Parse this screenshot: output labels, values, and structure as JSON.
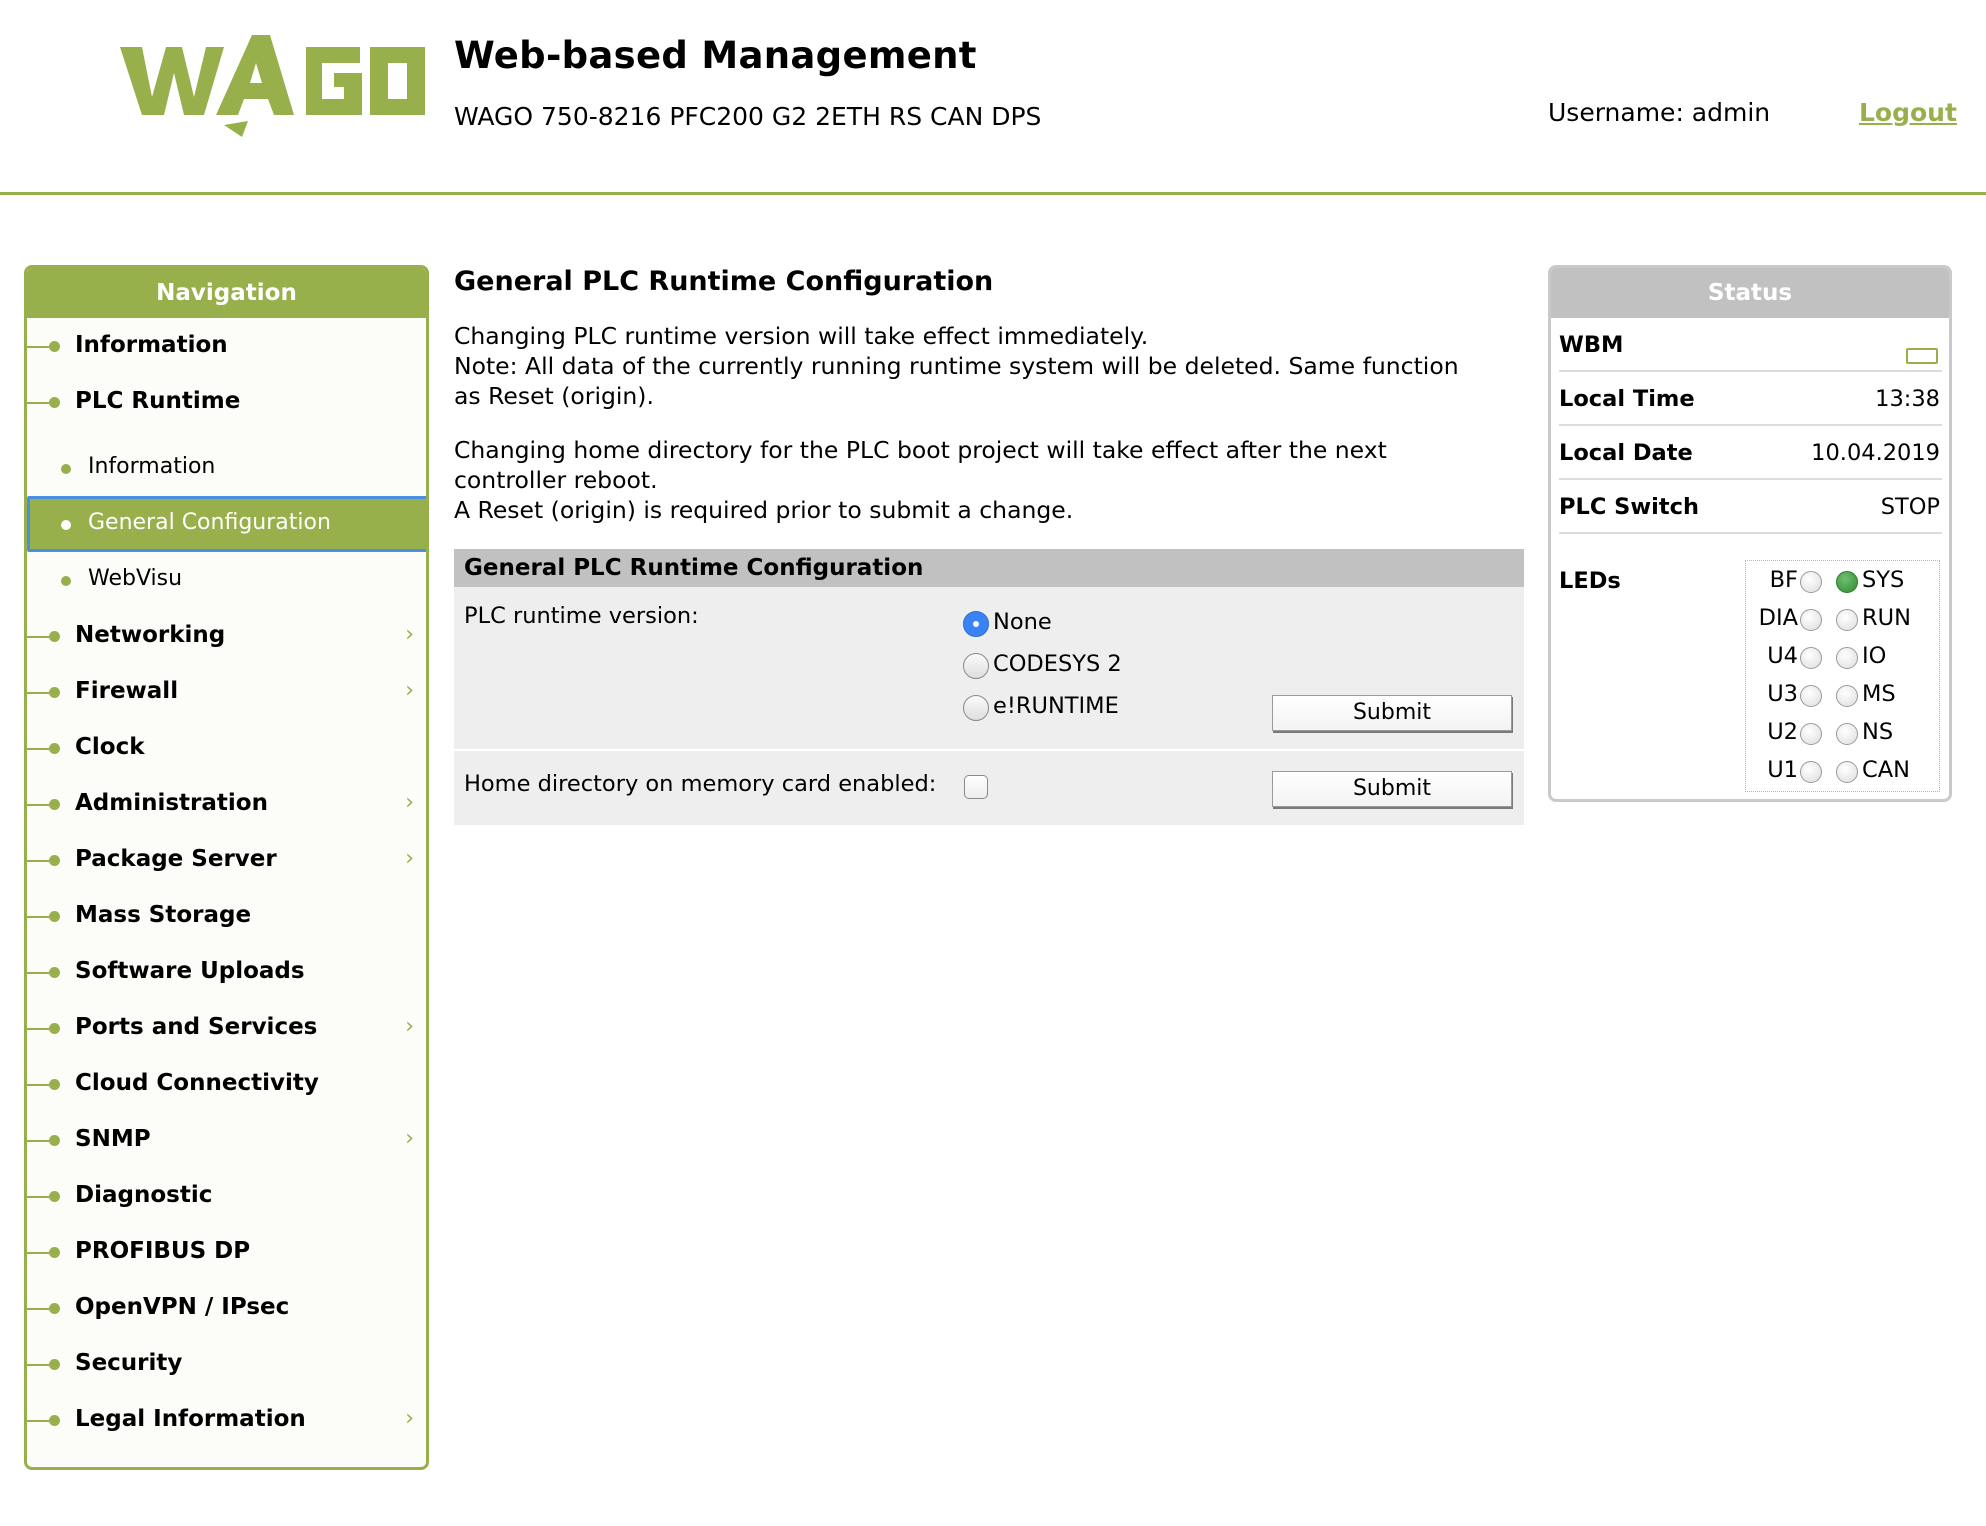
{
  "header": {
    "title": "Web-based Management",
    "device": "WAGO 750-8216 PFC200 G2 2ETH RS CAN DPS",
    "username": "Username: admin",
    "logout": "Logout",
    "logo_text": "WAGO"
  },
  "colors": {
    "brand_green": "#98b04b",
    "panel_gray": "#c1c1c1",
    "selection_blue": "#4a90e2",
    "led_on": "#3a9a3a"
  },
  "nav": {
    "title": "Navigation",
    "items": [
      {
        "label": "Information",
        "chevron": false
      },
      {
        "label": "PLC Runtime",
        "chevron": false
      },
      {
        "label": "Networking",
        "chevron": true
      },
      {
        "label": "Firewall",
        "chevron": true
      },
      {
        "label": "Clock",
        "chevron": false
      },
      {
        "label": "Administration",
        "chevron": true
      },
      {
        "label": "Package Server",
        "chevron": true
      },
      {
        "label": "Mass Storage",
        "chevron": false
      },
      {
        "label": "Software Uploads",
        "chevron": false
      },
      {
        "label": "Ports and Services",
        "chevron": true
      },
      {
        "label": "Cloud Connectivity",
        "chevron": false
      },
      {
        "label": "SNMP",
        "chevron": true
      },
      {
        "label": "Diagnostic",
        "chevron": false
      },
      {
        "label": "PROFIBUS DP",
        "chevron": false
      },
      {
        "label": "OpenVPN / IPsec",
        "chevron": false
      },
      {
        "label": "Security",
        "chevron": false
      },
      {
        "label": "Legal Information",
        "chevron": true
      }
    ],
    "sub_items": [
      {
        "label": "Information",
        "active": false
      },
      {
        "label": "General Configuration",
        "active": true
      },
      {
        "label": "WebVisu",
        "active": false
      }
    ]
  },
  "main": {
    "title": "General PLC Runtime Configuration",
    "para1": [
      "Changing PLC runtime version will take effect immediately.",
      "Note: All data of the currently running runtime system will be deleted. Same function",
      "as Reset (origin)."
    ],
    "para2": [
      "Changing home directory for the PLC boot project will take effect after the next",
      "controller reboot.",
      "A Reset (origin) is required prior to submit a change."
    ],
    "panel_title": "General PLC Runtime Configuration",
    "runtime_label": "PLC runtime version:",
    "runtime_options": [
      {
        "label": "None",
        "checked": true
      },
      {
        "label": "CODESYS 2",
        "checked": false
      },
      {
        "label": "e!RUNTIME",
        "checked": false
      }
    ],
    "home_label": "Home directory on memory card enabled:",
    "home_enabled": false,
    "submit_label": "Submit"
  },
  "status": {
    "title": "Status",
    "rows": [
      {
        "key": "WBM",
        "value": ""
      },
      {
        "key": "Local Time",
        "value": "13:38"
      },
      {
        "key": "Local Date",
        "value": "10.04.2019"
      },
      {
        "key": "PLC Switch",
        "value": "STOP"
      }
    ],
    "leds_label": "LEDs",
    "leds": [
      {
        "left": "BF",
        "left_on": false,
        "right": "SYS",
        "right_on": true
      },
      {
        "left": "DIA",
        "left_on": false,
        "right": "RUN",
        "right_on": false
      },
      {
        "left": "U4",
        "left_on": false,
        "right": "IO",
        "right_on": false
      },
      {
        "left": "U3",
        "left_on": false,
        "right": "MS",
        "right_on": false
      },
      {
        "left": "U2",
        "left_on": false,
        "right": "NS",
        "right_on": false
      },
      {
        "left": "U1",
        "left_on": false,
        "right": "CAN",
        "right_on": false
      }
    ]
  }
}
